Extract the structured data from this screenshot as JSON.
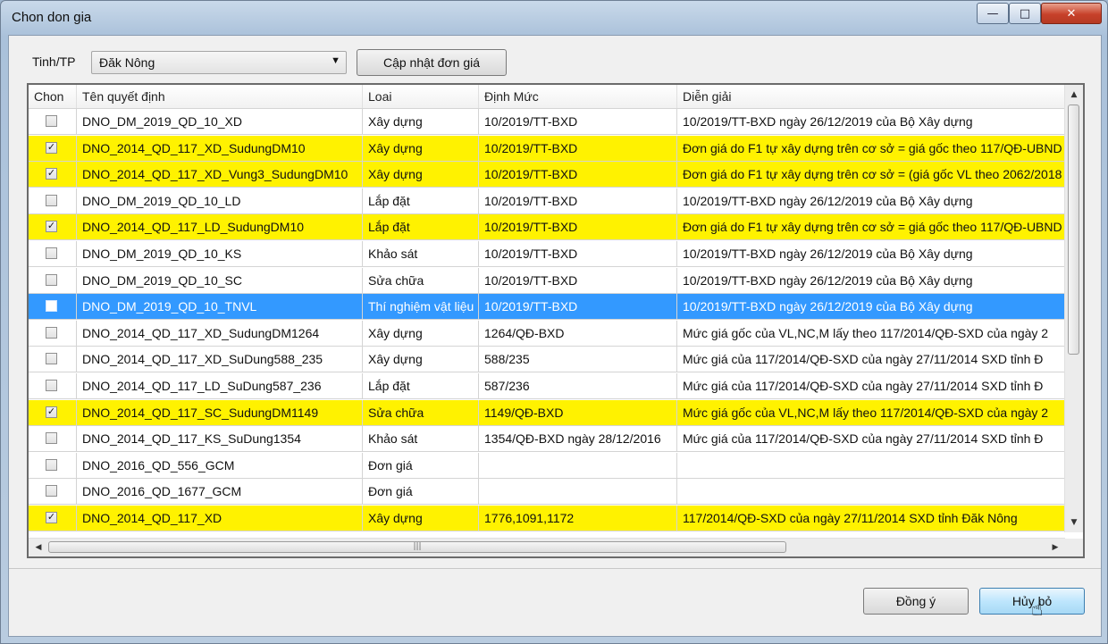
{
  "window": {
    "title": "Chon don gia",
    "controls": {
      "minimize": "—",
      "maximize": "□",
      "close": "✕"
    }
  },
  "filter": {
    "label": "Tinh/TP",
    "province_value": "Đăk Nông",
    "update_button": "Cập nhật đơn giá"
  },
  "grid": {
    "columns": [
      "Chon",
      "Tên quyết định",
      "Loai",
      "Định Mức",
      "Diễn giải"
    ],
    "rows": [
      {
        "checked": false,
        "highlight": "none",
        "name": "DNO_DM_2019_QD_10_XD",
        "loai": "Xây dựng",
        "dinhmuc": "10/2019/TT-BXD",
        "diengiai": "10/2019/TT-BXD ngày 26/12/2019 của Bộ Xây dựng"
      },
      {
        "checked": true,
        "highlight": "yellow",
        "name": "DNO_2014_QD_117_XD_SudungDM10",
        "loai": "Xây dựng",
        "dinhmuc": "10/2019/TT-BXD",
        "diengiai": "Đơn giá do F1 tự xây dựng trên cơ sở = giá gốc theo 117/QĐ-UBND"
      },
      {
        "checked": true,
        "highlight": "yellow",
        "name": "DNO_2014_QD_117_XD_Vung3_SudungDM10",
        "loai": "Xây dựng",
        "dinhmuc": "10/2019/TT-BXD",
        "diengiai": "Đơn giá do F1 tự xây dựng trên cơ sở = (giá gốc VL theo 2062/2018"
      },
      {
        "checked": false,
        "highlight": "none",
        "name": "DNO_DM_2019_QD_10_LD",
        "loai": "Lắp đặt",
        "dinhmuc": "10/2019/TT-BXD",
        "diengiai": "10/2019/TT-BXD ngày 26/12/2019 của Bộ Xây dựng"
      },
      {
        "checked": true,
        "highlight": "yellow",
        "name": "DNO_2014_QD_117_LD_SudungDM10",
        "loai": "Lắp đặt",
        "dinhmuc": "10/2019/TT-BXD",
        "diengiai": "Đơn giá do F1 tự xây dựng trên cơ sở = giá gốc theo 117/QĐ-UBND"
      },
      {
        "checked": false,
        "highlight": "none",
        "name": "DNO_DM_2019_QD_10_KS",
        "loai": "Khảo sát",
        "dinhmuc": "10/2019/TT-BXD",
        "diengiai": "10/2019/TT-BXD ngày 26/12/2019 của Bộ Xây dựng"
      },
      {
        "checked": false,
        "highlight": "none",
        "name": "DNO_DM_2019_QD_10_SC",
        "loai": "Sửa chữa",
        "dinhmuc": "10/2019/TT-BXD",
        "diengiai": "10/2019/TT-BXD ngày 26/12/2019 của Bộ Xây dựng"
      },
      {
        "checked": false,
        "highlight": "selected",
        "name": "DNO_DM_2019_QD_10_TNVL",
        "loai": "Thí nghiệm vật liệu",
        "dinhmuc": "10/2019/TT-BXD",
        "diengiai": "10/2019/TT-BXD ngày 26/12/2019 của Bộ Xây dựng"
      },
      {
        "checked": false,
        "highlight": "none",
        "name": "DNO_2014_QD_117_XD_SudungDM1264",
        "loai": "Xây dựng",
        "dinhmuc": "1264/QĐ-BXD",
        "diengiai": "Mức giá gốc của VL,NC,M lấy theo 117/2014/QĐ-SXD của ngày 2"
      },
      {
        "checked": false,
        "highlight": "none",
        "name": "DNO_2014_QD_117_XD_SuDung588_235",
        "loai": "Xây dựng",
        "dinhmuc": "588/235",
        "diengiai": "Mức giá của 117/2014/QĐ-SXD của ngày 27/11/2014 SXD tỉnh Đ"
      },
      {
        "checked": false,
        "highlight": "none",
        "name": "DNO_2014_QD_117_LD_SuDung587_236",
        "loai": "Lắp đặt",
        "dinhmuc": "587/236",
        "diengiai": "Mức giá của 117/2014/QĐ-SXD của ngày 27/11/2014 SXD tỉnh Đ"
      },
      {
        "checked": true,
        "highlight": "yellow",
        "name": "DNO_2014_QD_117_SC_SudungDM1149",
        "loai": "Sửa chữa",
        "dinhmuc": "1149/QĐ-BXD",
        "diengiai": "Mức giá gốc của VL,NC,M lấy theo 117/2014/QĐ-SXD của ngày 2"
      },
      {
        "checked": false,
        "highlight": "none",
        "name": "DNO_2014_QD_117_KS_SuDung1354",
        "loai": "Khảo sát",
        "dinhmuc": "1354/QĐ-BXD ngày 28/12/2016",
        "diengiai": "Mức giá của 117/2014/QĐ-SXD của ngày 27/11/2014 SXD tỉnh Đ"
      },
      {
        "checked": false,
        "highlight": "none",
        "name": "DNO_2016_QD_556_GCM",
        "loai": "Đơn giá",
        "dinhmuc": "",
        "diengiai": ""
      },
      {
        "checked": false,
        "highlight": "none",
        "name": "DNO_2016_QD_1677_GCM",
        "loai": "Đơn giá",
        "dinhmuc": "",
        "diengiai": ""
      },
      {
        "checked": true,
        "highlight": "yellow",
        "name": "DNO_2014_QD_117_XD",
        "loai": "Xây dựng",
        "dinhmuc": "1776,1091,1172",
        "diengiai": "117/2014/QĐ-SXD của ngày 27/11/2014 SXD tỉnh Đăk Nông"
      }
    ]
  },
  "footer": {
    "ok_button": "Đồng ý",
    "cancel_button": "Hủy bỏ"
  },
  "colors": {
    "highlight_row": "#fff200",
    "selected_row": "#3399ff"
  },
  "icons": {
    "combo_arrow": "chevron-down-icon",
    "checkmark": "checkmark-icon",
    "cursor": "mouse-pointer-icon"
  }
}
